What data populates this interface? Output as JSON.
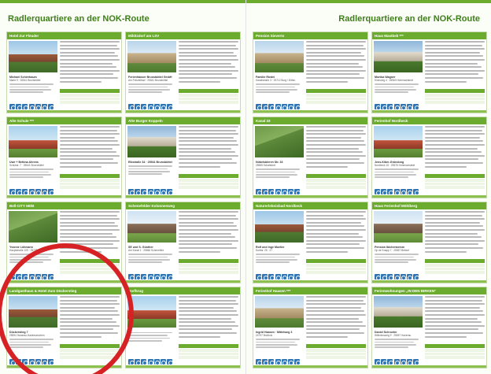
{
  "pages": {
    "left": {
      "heading": "Radlerquartiere an der NOK-Route",
      "accent": "#6bab2d"
    },
    "right": {
      "heading": "Radlerquartiere an der NOK-Route",
      "accent": "#6bab2d"
    }
  },
  "left_entries": [
    {
      "title": "Hotel Zur Fleuder",
      "name": "Michael Schierbaum",
      "addr": "Markt 9 · 25541 Brunsbüttel",
      "photo": "ph-a",
      "highlighted": false
    },
    {
      "title": "Miltitzdorf am LSV",
      "name": "Ferienhäuser Brunsbüttel GmbH",
      "addr": "Am Freizeitbad · 25541 Brunsbüttel",
      "photo": "ph-b",
      "highlighted": false
    },
    {
      "title": "Alte Schule ***",
      "name": "Uwe + Bettina Ahrens",
      "addr": "Schulstr. 7 · 25541 Brunsbüttel",
      "photo": "ph-c",
      "highlighted": false
    },
    {
      "title": "Alte Burger Koppeln",
      "name": "Elbstraße 34 · 25541 Brunsbüttel",
      "addr": "",
      "photo": "ph-d",
      "highlighted": false
    },
    {
      "title": "Bell-CITY 6B/B",
      "name": "Yvonne Lühmann",
      "addr": "Hauptstraße 109 · 25775 Lemkühl",
      "photo": "ph-e",
      "highlighted": false
    },
    {
      "title": "Schenefelder Kolonnenweg",
      "name": "SE und S. Günther",
      "addr": "Am Kanal 1 · 25560 Schenefeld",
      "photo": "ph-f",
      "highlighted": false
    },
    {
      "title": "Landgasthaus & Hotel Zum Dückerstieg",
      "name": "Dückerstieg 7",
      "addr": "25594 Hanerau-Hademarschen",
      "photo": "ph-a",
      "highlighted": true
    },
    {
      "title": "Dorfkrug",
      "name": "",
      "addr": "",
      "photo": "ph-c",
      "highlighted": false
    }
  ],
  "right_entries": [
    {
      "title": "Pension Sieverts",
      "name": "Familie Riedel",
      "addr": "Kanalstraße 3 · 25712 Burg / Dithm.",
      "photo": "ph-b",
      "highlighted": false
    },
    {
      "title": "Haus Mastbek ***",
      "name": "Monika Wagner",
      "addr": "Kirchweg 4 · 25560 Hohenwestedt",
      "photo": "ph-d",
      "highlighted": false
    },
    {
      "title": "Kanal 33",
      "name": "Nübelsbieren Str. 33",
      "addr": "25585 Schafstedt",
      "photo": "ph-e",
      "highlighted": false
    },
    {
      "title": "Ferienhof Nordbeck",
      "name": "Jens-Kiber-Gründung",
      "addr": "Nordbeck 15 · 25576 Hohenwestedt",
      "photo": "ph-c",
      "highlighted": false
    },
    {
      "title": "Naturerlebnisbad Nordbeck",
      "name": "Rolf und Inge Mueller",
      "addr": "Dorfstr. 25 · 27",
      "photo": "ph-a",
      "highlighted": false
    },
    {
      "title": "Haus Ferienhof Möhlberg",
      "name": "Pension Ibichenkemm",
      "addr": "Op de Knapp 7 · 25557 Beldorf",
      "photo": "ph-f",
      "highlighted": false
    },
    {
      "title": "Ferienhof Haasen ***",
      "name": "Ingrid Haasen · Mittelweg 3",
      "addr": "24797 Breiholz",
      "photo": "ph-b",
      "highlighted": false
    },
    {
      "title": "Ferienwohnungen „IN DEN BIRKEN“",
      "name": "Daniel Schroeter",
      "addr": "Wilhelmsweg 9 · 25557 Hanerau",
      "photo": "ph-d",
      "highlighted": false
    }
  ]
}
